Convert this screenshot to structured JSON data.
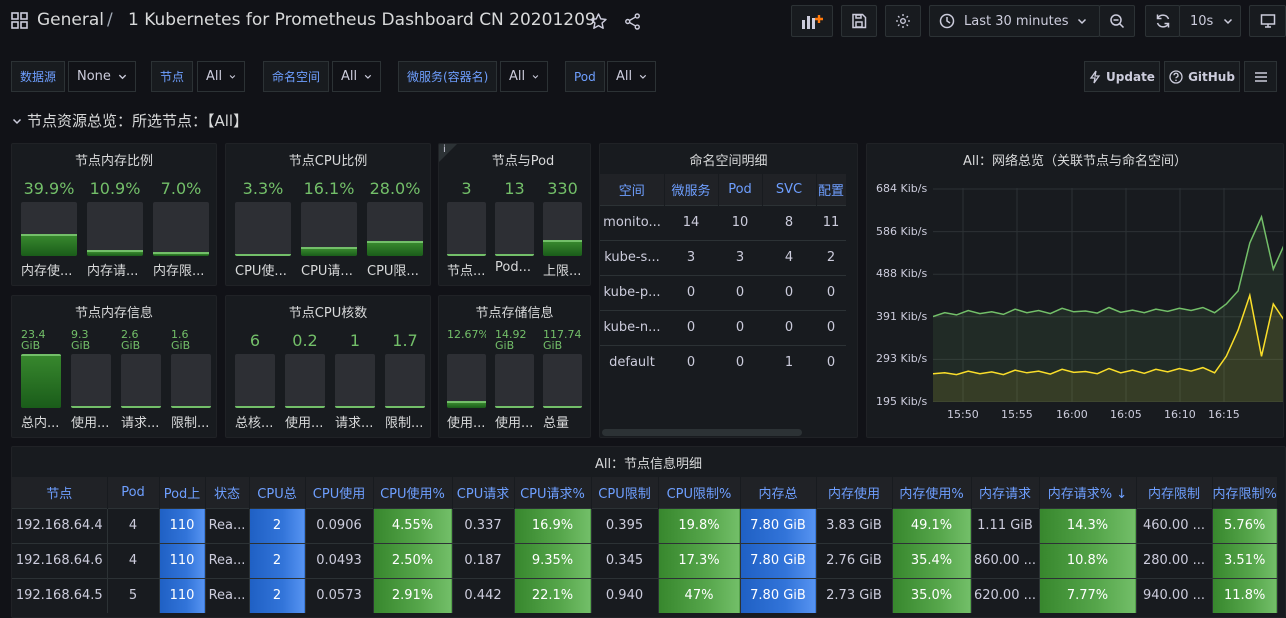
{
  "header": {
    "breadcrumb_root": "General",
    "separator": "/",
    "title": "1 Kubernetes for Prometheus Dashboard CN 20201209",
    "time_range": "Last 30 minutes",
    "refresh_interval": "10s"
  },
  "variables": [
    {
      "label": "数据源",
      "value": "None"
    },
    {
      "label": "节点",
      "value": "All"
    },
    {
      "label": "命名空间",
      "value": "All"
    },
    {
      "label": "微服务(容器名)",
      "value": "All"
    },
    {
      "label": "Pod",
      "value": "All"
    }
  ],
  "actions": {
    "update": "Update",
    "github": "GitHub"
  },
  "row_title": "节点资源总览：所选节点：【All】",
  "mem_ratio": {
    "title": "节点内存比例",
    "gauges": [
      {
        "value": "39.9%",
        "label": "内存使...",
        "fill": 39.9
      },
      {
        "value": "10.9%",
        "label": "内存请...",
        "fill": 10.9
      },
      {
        "value": "7.0%",
        "label": "内存限...",
        "fill": 7.0
      }
    ]
  },
  "cpu_ratio": {
    "title": "节点CPU比例",
    "gauges": [
      {
        "value": "3.3%",
        "label": "CPU使...",
        "fill": 3.3
      },
      {
        "value": "16.1%",
        "label": "CPU请...",
        "fill": 16.1
      },
      {
        "value": "28.0%",
        "label": "CPU限...",
        "fill": 28.0
      }
    ]
  },
  "node_pod": {
    "title": "节点与Pod",
    "info": "i",
    "gauges": [
      {
        "value": "3",
        "label": "节点...",
        "fill": 3
      },
      {
        "value": "13",
        "label": "Pod...",
        "fill": 4
      },
      {
        "value": "330",
        "label": "上限...",
        "fill": 30
      }
    ]
  },
  "mem_info": {
    "title": "节点内存信息",
    "gauges": [
      {
        "value": "23.4 GiB",
        "label": "总内...",
        "fill": 100
      },
      {
        "value": "9.3 GiB",
        "label": "使用...",
        "fill": 3
      },
      {
        "value": "2.6 GiB",
        "label": "请求...",
        "fill": 3
      },
      {
        "value": "1.6 GiB",
        "label": "限制...",
        "fill": 3
      }
    ]
  },
  "cpu_cores": {
    "title": "节点CPU核数",
    "gauges": [
      {
        "value": "6",
        "label": "总核...",
        "fill": 3
      },
      {
        "value": "0.2",
        "label": "使用...",
        "fill": 3
      },
      {
        "value": "1",
        "label": "请求...",
        "fill": 3
      },
      {
        "value": "1.7",
        "label": "限制...",
        "fill": 3
      }
    ]
  },
  "storage_info": {
    "title": "节点存储信息",
    "gauges": [
      {
        "value": "12.67%",
        "label": "使用...",
        "fill": 12.67
      },
      {
        "value": "14.92 GiB",
        "label": "使用...",
        "fill": 3
      },
      {
        "value": "117.74 GiB",
        "label": "总量",
        "fill": 3
      }
    ]
  },
  "namespace_table": {
    "title": "命名空间明细",
    "columns": [
      "空间",
      "微服务",
      "Pod",
      "SVC",
      "配置"
    ],
    "rows": [
      [
        "monito...",
        "14",
        "10",
        "8",
        "11"
      ],
      [
        "kube-s...",
        "3",
        "3",
        "4",
        "2"
      ],
      [
        "kube-p...",
        "0",
        "0",
        "0",
        "0"
      ],
      [
        "kube-n...",
        "0",
        "0",
        "0",
        "0"
      ],
      [
        "default",
        "0",
        "0",
        "1",
        "0"
      ]
    ]
  },
  "network": {
    "title": "All：网络总览（关联节点与命名空间）",
    "y_ticks": [
      "684 Kib/s",
      "586 Kib/s",
      "488 Kib/s",
      "391 Kib/s",
      "293 Kib/s",
      "195 Kib/s"
    ],
    "x_ticks": [
      "15:50",
      "15:55",
      "16:00",
      "16:05",
      "16:10",
      "16:15"
    ],
    "series_colors": {
      "green": "#73bf69",
      "yellow": "#fade2a"
    }
  },
  "chart_data": {
    "type": "line",
    "ylim": [
      195,
      684
    ],
    "x_ticks": [
      "15:50",
      "15:55",
      "16:00",
      "16:05",
      "16:10",
      "16:15"
    ],
    "series": [
      {
        "color": "#73bf69",
        "values": [
          391,
          400,
          395,
          405,
          398,
          402,
          396,
          408,
          400,
          405,
          398,
          410,
          402,
          404,
          399,
          412,
          401,
          406,
          400,
          408,
          403,
          410,
          405,
          412,
          400,
          420,
          450,
          560,
          620,
          500,
          560
        ]
      },
      {
        "color": "#fade2a",
        "values": [
          260,
          262,
          258,
          266,
          260,
          264,
          258,
          268,
          262,
          266,
          259,
          270,
          263,
          265,
          260,
          272,
          262,
          268,
          261,
          270,
          264,
          272,
          266,
          274,
          262,
          300,
          360,
          440,
          300,
          420,
          380
        ]
      }
    ]
  },
  "node_table": {
    "title": "All：节点信息明细",
    "columns": [
      "节点",
      "Pod",
      "Pod上",
      "状态",
      "CPU总",
      "CPU使用",
      "CPU使用%",
      "CPU请求",
      "CPU请求%",
      "CPU限制",
      "CPU限制%",
      "内存总",
      "内存使用",
      "内存使用%",
      "内存请求",
      "内存请求% ↓",
      "内存限制",
      "内存限制%"
    ],
    "rows": [
      [
        "192.168.64.4",
        "4",
        "110",
        "Rea...",
        "2",
        "0.0906",
        "4.55%",
        "0.337",
        "16.9%",
        "0.395",
        "19.8%",
        "7.80 GiB",
        "3.83 GiB",
        "49.1%",
        "1.11 GiB",
        "14.3%",
        "460.00 ...",
        "5.76%"
      ],
      [
        "192.168.64.6",
        "4",
        "110",
        "Rea...",
        "2",
        "0.0493",
        "2.50%",
        "0.187",
        "9.35%",
        "0.345",
        "17.3%",
        "7.80 GiB",
        "2.76 GiB",
        "35.4%",
        "860.00 ...",
        "10.8%",
        "280.00 ...",
        "3.51%"
      ],
      [
        "192.168.64.5",
        "5",
        "110",
        "Rea...",
        "2",
        "0.0573",
        "2.91%",
        "0.442",
        "22.1%",
        "0.940",
        "47%",
        "7.80 GiB",
        "2.73 GiB",
        "35.0%",
        "620.00 ...",
        "7.77%",
        "940.00 ...",
        "11.8%"
      ]
    ],
    "cell_colors": [
      "",
      "",
      "blue",
      "",
      "blue",
      "",
      "green",
      "",
      "green",
      "",
      "green",
      "blue",
      "",
      "green",
      "",
      "green",
      "",
      "green"
    ]
  }
}
